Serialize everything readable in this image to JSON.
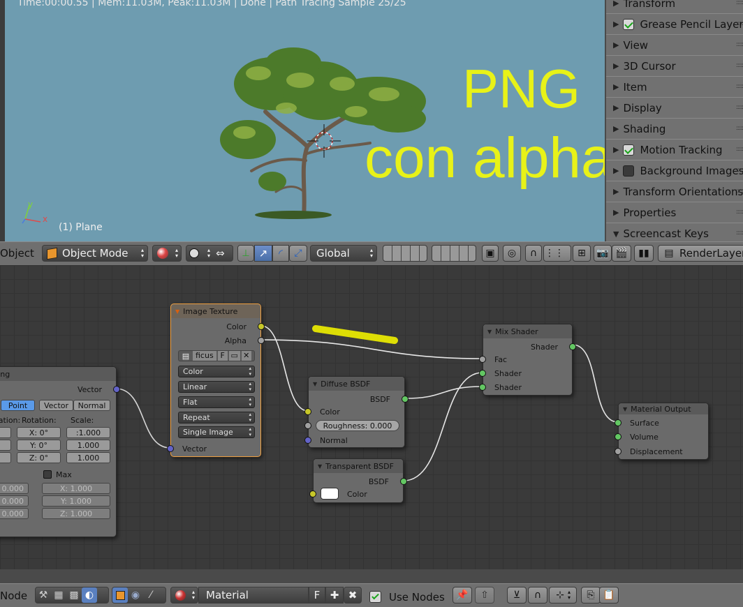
{
  "viewport": {
    "status": "Time:00:00.55 | Mem:11.03M, Peak:11.03M | Done | Path Tracing Sample 25/25",
    "overlay_line1": "PNG",
    "overlay_line2": "con alpha",
    "object_label": "(1) Plane",
    "axis_y": "y",
    "axis_x": "x",
    "bg_color": "#6e9cb0",
    "overlay_color": "#e8f218"
  },
  "npanel": {
    "items": [
      {
        "label": "Transform",
        "check": null
      },
      {
        "label": "Grease Pencil Layers",
        "check": true
      },
      {
        "label": "View",
        "check": null
      },
      {
        "label": "3D Cursor",
        "check": null
      },
      {
        "label": "Item",
        "check": null
      },
      {
        "label": "Display",
        "check": null
      },
      {
        "label": "Shading",
        "check": null
      },
      {
        "label": "Motion Tracking",
        "check": true
      },
      {
        "label": "Background Images",
        "check": false
      },
      {
        "label": "Transform Orientations",
        "check": null
      },
      {
        "label": "Properties",
        "check": null
      },
      {
        "label": "Screencast Keys",
        "check": null,
        "open": true
      }
    ]
  },
  "header3d": {
    "object_menu": "Object",
    "mode": "Object Mode",
    "orientation": "Global",
    "render_layer": "RenderLayer"
  },
  "nodes": {
    "mapping": {
      "title": "Mapping",
      "vector_out": "Vector",
      "tabs": [
        "Point",
        "Vector",
        "Normal"
      ],
      "col_location": "Location:",
      "col_rotation": "Rotation:",
      "col_scale": "Scale:",
      "rot_x": "X:    0°",
      "rot_y": "Y:    0°",
      "rot_z": "Z:    0°",
      "scale_x": ":1.000",
      "scale_y": "1.000",
      "scale_z": "1.000",
      "min_x": "0.000",
      "min_y": "0.000",
      "min_z": "0.000",
      "max_label": "Max",
      "max_x": "X:            1.000",
      "max_y": "Y:            1.000",
      "max_z": "Z:            1.000"
    },
    "image_texture": {
      "title": "Image Texture",
      "out_color": "Color",
      "out_alpha": "Alpha",
      "image_name": "ficus",
      "image_flag": "F",
      "color_space": "Color",
      "interpolation": "Linear",
      "projection": "Flat",
      "extension": "Repeat",
      "source": "Single Image",
      "in_vector": "Vector"
    },
    "diffuse": {
      "title": "Diffuse BSDF",
      "out": "BSDF",
      "in_color": "Color",
      "roughness": "Roughness:  0.000",
      "in_normal": "Normal"
    },
    "transparent": {
      "title": "Transparent BSDF",
      "out": "BSDF",
      "in_color": "Color"
    },
    "mix": {
      "title": "Mix Shader",
      "out": "Shader",
      "in_fac": "Fac",
      "in_shader1": "Shader",
      "in_shader2": "Shader"
    },
    "output": {
      "title": "Material Output",
      "in_surface": "Surface",
      "in_volume": "Volume",
      "in_displacement": "Displacement"
    }
  },
  "header_node": {
    "menu": "Node",
    "material": "Material",
    "material_flag": "F",
    "use_nodes": "Use Nodes"
  }
}
